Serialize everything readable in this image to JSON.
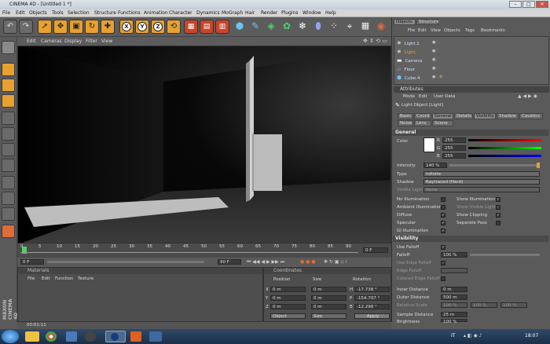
{
  "window": {
    "title": "CINEMA 4D - [Untitled 1 *]",
    "min": "–",
    "max": "□",
    "close": "✕"
  },
  "menu": [
    "File",
    "Edit",
    "Objects",
    "Tools",
    "Selection",
    "Structure",
    "Functions",
    "Animation",
    "Character",
    "Dynamics",
    "MoGraph",
    "Hair",
    "Render",
    "Plugins",
    "Window",
    "Help"
  ],
  "toolbar": {
    "axis_x": "X",
    "axis_y": "Y",
    "axis_z": "Z"
  },
  "viewport": {
    "menu": [
      "Edit",
      "Cameras",
      "Display",
      "Filter",
      "View"
    ]
  },
  "timeline": {
    "ticks": [
      "0",
      "5",
      "10",
      "15",
      "20",
      "25",
      "30",
      "35",
      "40",
      "45",
      "50",
      "55",
      "60",
      "65",
      "70",
      "75",
      "80",
      "85",
      "90"
    ],
    "end_label": "0 F"
  },
  "transport": {
    "start": "0 F",
    "end": "90 F"
  },
  "materials": {
    "title": "Materials",
    "menu": [
      "File",
      "Edit",
      "Function",
      "Texture"
    ]
  },
  "coordinates": {
    "title": "Coordinates",
    "headers": {
      "position": "Position",
      "size": "Size",
      "rotation": "Rotation"
    },
    "rows": [
      {
        "axis": "X",
        "pos": "0 m",
        "size": "0 m",
        "rot_axis": "H",
        "rot": "-17.738 °"
      },
      {
        "axis": "Y",
        "pos": "0 m",
        "size": "0 m",
        "rot_axis": "P",
        "rot": "-154.707 °"
      },
      {
        "axis": "Z",
        "pos": "0 m",
        "size": "0 m",
        "rot_axis": "B",
        "rot": "-12.298 °"
      }
    ],
    "mode": "Object",
    "size_mode": "Size",
    "apply": "Apply"
  },
  "objects": {
    "tabs": [
      "Objects",
      "Structure"
    ],
    "menu": [
      "File",
      "Edit",
      "View",
      "Objects",
      "Tags",
      "Bookmarks"
    ],
    "items": [
      {
        "name": "Light.1",
        "color": "#cfe0ff"
      },
      {
        "name": "Light",
        "color": "#ff9a2e"
      },
      {
        "name": "Camera",
        "color": "#cfe0ff"
      },
      {
        "name": "Floor",
        "color": "#cfe0ff"
      },
      {
        "name": "Cube.4",
        "color": "#cfe0ff"
      }
    ]
  },
  "attributes": {
    "title": "Attributes",
    "menu": [
      "Mode",
      "Edit",
      "User Data"
    ],
    "object_title": "Light Object [Light]",
    "tabs_row1": [
      "Basic",
      "Coord.",
      "General",
      "Details",
      "Visibility",
      "Shadow",
      "Caustics"
    ],
    "tabs_row2": [
      "Noise",
      "Lens",
      "Scene"
    ],
    "section_general": "General",
    "color_label": "Color",
    "rgb": [
      {
        "ch": "R",
        "val": "255"
      },
      {
        "ch": "G",
        "val": "255"
      },
      {
        "ch": "B",
        "val": "255"
      }
    ],
    "intensity_label": "Intensity",
    "intensity": "140 %",
    "type_label": "Type",
    "type": "Infinite",
    "shadow_label": "Shadow",
    "shadow": "Raytraced (Hard)",
    "visible_light_label": "Visible Light",
    "visible_light": "None",
    "checks_left": [
      {
        "label": "No Illumination",
        "checked": false
      },
      {
        "label": "Ambient Illumination",
        "checked": false
      },
      {
        "label": "Diffuse",
        "checked": true
      },
      {
        "label": "Specular",
        "checked": true
      },
      {
        "label": "GI Illumination",
        "checked": true
      }
    ],
    "checks_right": [
      {
        "label": "Show Illumination",
        "checked": true
      },
      {
        "label": "Show Visible Light",
        "checked": true
      },
      {
        "label": "Show Clipping",
        "checked": true
      },
      {
        "label": "Separate Pass",
        "checked": false
      }
    ],
    "section_visibility": "Visibility",
    "use_falloff": "Use Falloff",
    "falloff_label": "Falloff",
    "falloff": "100 %",
    "use_edge_falloff": "Use Edge Falloff",
    "edge_falloff": "Edge Falloff",
    "colored_edge_falloff": "Colored Edge Falloff",
    "inner_distance_label": "Inner Distance",
    "inner_distance": "0 m",
    "outer_distance_label": "Outer Distance",
    "outer_distance": "500 m",
    "relative_scale_label": "Relative Scale",
    "relative_scale": "100 %",
    "sample_distance_label": "Sample Distance",
    "sample_distance": "25 m",
    "brightness_label": "Brightness",
    "brightness": "100 %"
  },
  "status": {
    "time": "00:01:11"
  },
  "taskbar": {
    "lang": "IT",
    "clock": "18:07"
  },
  "brand": "MAXON CINEMA 4D",
  "colors": {
    "accent": "#e8a030",
    "title_bg": "#dde3ea",
    "panel": "#5a5a5a"
  }
}
